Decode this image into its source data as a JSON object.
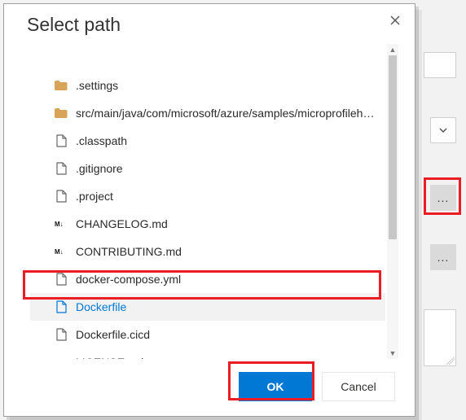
{
  "modal": {
    "title": "Select path",
    "ok_label": "OK",
    "cancel_label": "Cancel"
  },
  "files": [
    {
      "name": "",
      "type": "blank"
    },
    {
      "name": ".settings",
      "type": "folder"
    },
    {
      "name": "src/main/java/com/microsoft/azure/samples/microprofilehelloa...",
      "type": "folder"
    },
    {
      "name": ".classpath",
      "type": "file"
    },
    {
      "name": ".gitignore",
      "type": "file"
    },
    {
      "name": ".project",
      "type": "file"
    },
    {
      "name": "CHANGELOG.md",
      "type": "md"
    },
    {
      "name": "CONTRIBUTING.md",
      "type": "md"
    },
    {
      "name": "docker-compose.yml",
      "type": "file"
    },
    {
      "name": "Dockerfile",
      "type": "file",
      "selected": true
    },
    {
      "name": "Dockerfile.cicd",
      "type": "file"
    },
    {
      "name": "LICENSE.md",
      "type": "md"
    }
  ],
  "icons": {
    "folder_color": "#d8a45a",
    "file_stroke": "#666666",
    "md_label": "M↓"
  },
  "background": {
    "browse_glyph": "..."
  }
}
